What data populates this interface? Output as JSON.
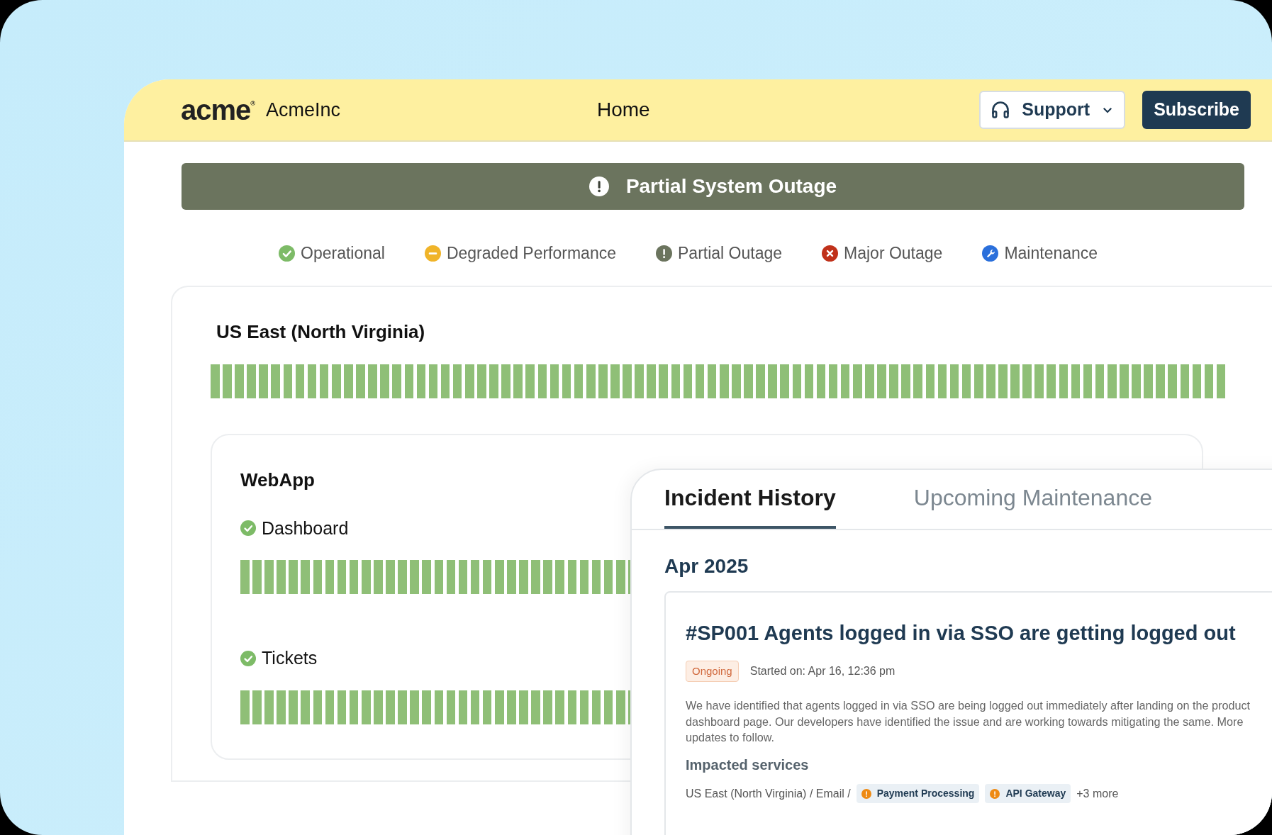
{
  "header": {
    "logo": "acme",
    "logo_mark": "®",
    "brand": "AcmeInc",
    "nav": "Home",
    "support": "Support",
    "subscribe": "Subscribe"
  },
  "banner": {
    "text": "Partial System Outage",
    "kind": "partial"
  },
  "legend": [
    {
      "kind": "operational",
      "label": "Operational"
    },
    {
      "kind": "degraded",
      "label": "Degraded Performance"
    },
    {
      "kind": "partial",
      "label": "Partial Outage"
    },
    {
      "kind": "major",
      "label": "Major Outage"
    },
    {
      "kind": "maintenance",
      "label": "Maintenance"
    }
  ],
  "region": {
    "title": "US East (North Virginia)",
    "kind": "operational"
  },
  "group": {
    "title": "WebApp",
    "services": [
      {
        "name": "Dashboard",
        "kind": "operational"
      },
      {
        "name": "Tickets",
        "kind": "operational"
      }
    ]
  },
  "incidents_panel": {
    "tabs": [
      {
        "label": "Incident History",
        "selected": true
      },
      {
        "label": "Upcoming Maintenance",
        "selected": false
      }
    ],
    "month": "Apr 2025",
    "incident": {
      "title": "#SP001 Agents logged in via SSO are getting logged out",
      "badge": "Ongoing",
      "started": "Started on: Apr 16, 12:36 pm",
      "description": "We have identified that agents logged in via SSO are being logged out immediately after landing on the product dashboard page. Our developers have identified the issue and are working towards mitigating the same. More updates to follow.",
      "impacted_title": "Impacted services",
      "path": "US East (North Virginia) / Email /",
      "tags": [
        {
          "label": "Payment Processing",
          "kind": "warning"
        },
        {
          "label": "API Gateway",
          "kind": "warning"
        }
      ],
      "more": "+3 more"
    }
  }
}
